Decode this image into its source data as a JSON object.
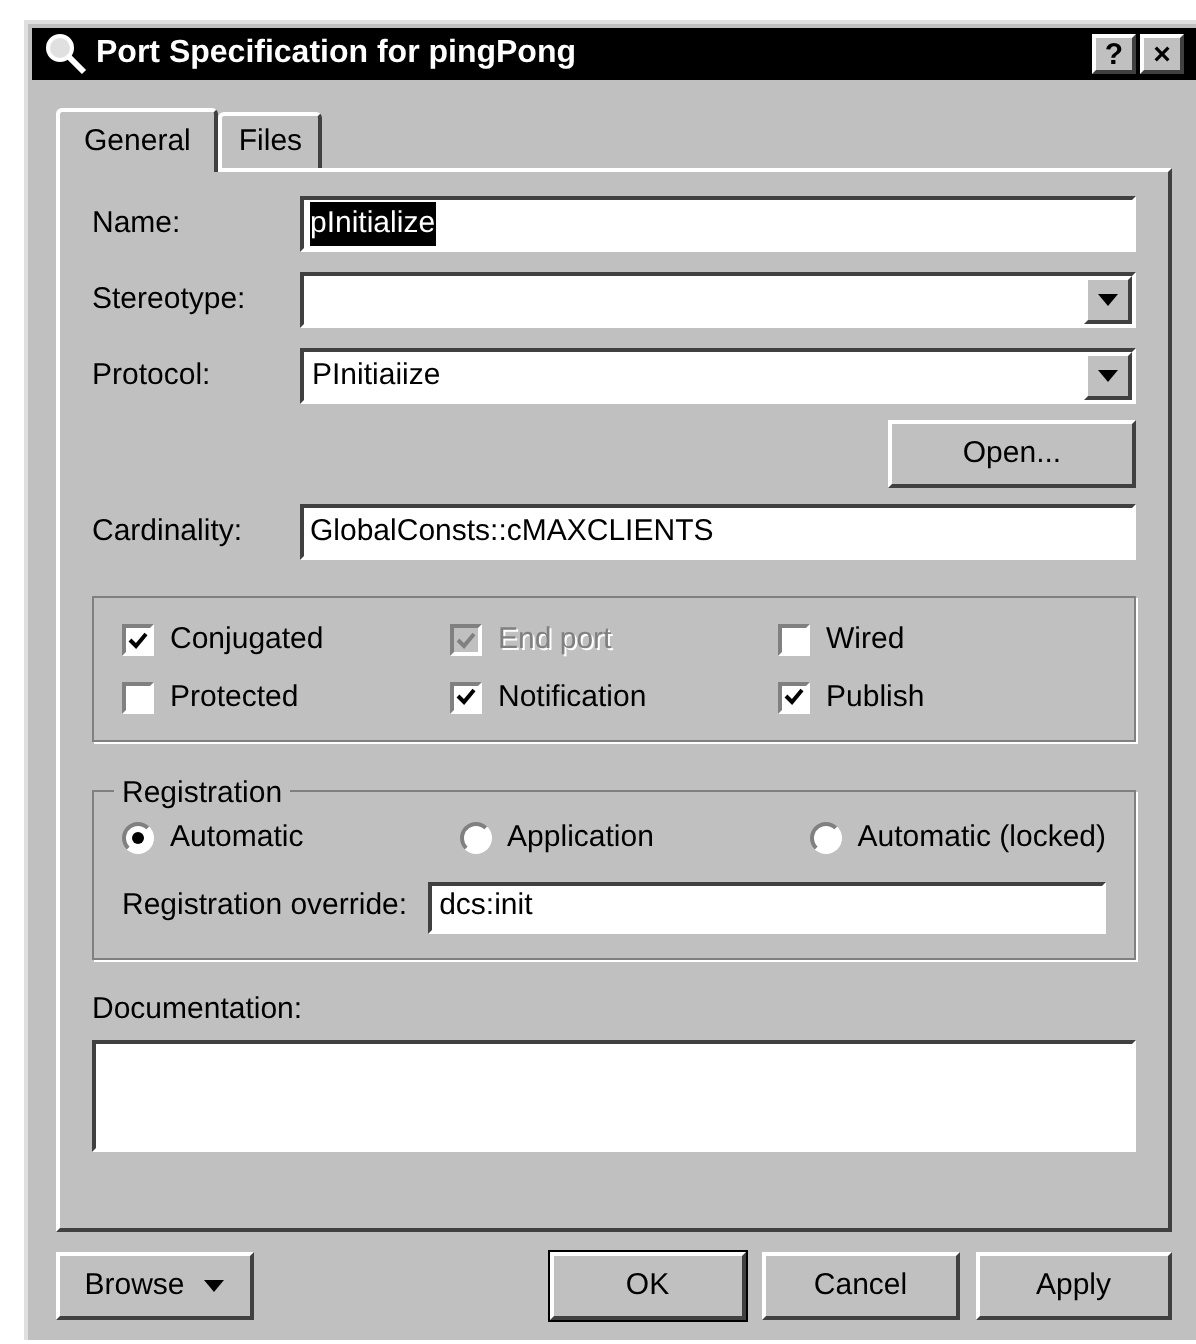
{
  "window": {
    "title": "Port Specification for pingPong",
    "buttons": [
      "?",
      "×"
    ]
  },
  "tabs": [
    {
      "label": "General",
      "selected": true
    },
    {
      "label": "Files",
      "selected": false
    }
  ],
  "fields": [
    {
      "kind": "text",
      "label": "Name:",
      "value": "pInitialize",
      "highlighted": true
    },
    {
      "kind": "combo",
      "label": "Stereotype:"
    },
    {
      "kind": "combo",
      "label": "Protocol:",
      "value": "PInitiaiize"
    },
    {
      "kind": "button",
      "label": "Open..."
    },
    {
      "kind": "text",
      "label": "Cardinality:",
      "value": "GlobalConsts::cMAXCLIENTS",
      "highlighted": false
    }
  ],
  "options": [
    {
      "label": "Conjugated",
      "checked": true,
      "disabled": false
    },
    {
      "label": "End port",
      "checked": true,
      "disabled": true
    },
    {
      "label": "Wired",
      "checked": false,
      "disabled": false
    },
    {
      "label": "Protected",
      "checked": false,
      "disabled": false
    },
    {
      "label": "Notification",
      "checked": true,
      "disabled": false
    },
    {
      "label": "Publish",
      "checked": true,
      "disabled": false
    }
  ],
  "registration": {
    "title": "Registration",
    "choices": [
      {
        "label": "Automatic",
        "selected": true
      },
      {
        "label": "Application",
        "selected": false
      },
      {
        "label": "Automatic (locked)",
        "selected": false
      }
    ],
    "override_label": "Registration override:",
    "override_value": "dcs:init"
  },
  "documentation": {
    "label": "Documentation:"
  },
  "buttons": [
    {
      "kind": "menu",
      "label": "Browse"
    },
    {
      "kind": "default",
      "label": "OK"
    },
    {
      "kind": "plain",
      "label": "Cancel"
    },
    {
      "kind": "plain",
      "label": "Apply"
    }
  ]
}
